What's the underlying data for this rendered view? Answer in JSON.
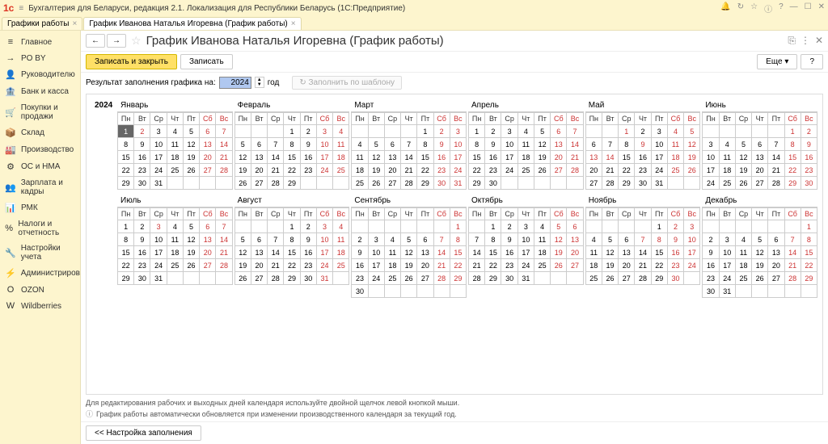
{
  "titlebar": {
    "logo": "1c",
    "title": "Бухгалтерия для Беларуси, редакция 2.1. Локализация для Республики Беларусь  (1С:Предприятие)"
  },
  "tabs": [
    {
      "label": "Графики работы",
      "active": false
    },
    {
      "label": "График Иванова Наталья Игоревна (График работы)",
      "active": true
    }
  ],
  "sidebar": [
    {
      "icon": "≡",
      "label": "Главное"
    },
    {
      "icon": "→",
      "label": "PO BY"
    },
    {
      "icon": "👤",
      "label": "Руководителю"
    },
    {
      "icon": "🏦",
      "label": "Банк и касса"
    },
    {
      "icon": "🛒",
      "label": "Покупки и продажи"
    },
    {
      "icon": "📦",
      "label": "Склад"
    },
    {
      "icon": "🏭",
      "label": "Производство"
    },
    {
      "icon": "⚙",
      "label": "ОС и НМА"
    },
    {
      "icon": "👥",
      "label": "Зарплата и кадры"
    },
    {
      "icon": "📊",
      "label": "РМК"
    },
    {
      "icon": "%",
      "label": "Налоги и отчетность"
    },
    {
      "icon": "🔧",
      "label": "Настройки учета"
    },
    {
      "icon": "⚡",
      "label": "Администрирование"
    },
    {
      "icon": "O",
      "label": "OZON"
    },
    {
      "icon": "W",
      "label": "Wildberries"
    }
  ],
  "header": {
    "title": "График Иванова Наталья Игоревна (График работы)"
  },
  "toolbar": {
    "save_close": "Записать и закрыть",
    "save": "Записать",
    "more": "Еще"
  },
  "filter": {
    "label_prefix": "Результат заполнения графика на:",
    "year": "2024",
    "label_suffix": "год",
    "template_btn": "Заполнить по шаблону"
  },
  "weekdays": [
    "Пн",
    "Вт",
    "Ср",
    "Чт",
    "Пт",
    "Сб",
    "Вс"
  ],
  "months_row1": [
    {
      "name": "Январь",
      "start": 0,
      "days": 31,
      "wknd": [
        6,
        7,
        13,
        14,
        20,
        21,
        27,
        28,
        1,
        2
      ],
      "today": 1
    },
    {
      "name": "Февраль",
      "start": 3,
      "days": 29,
      "wknd": [
        3,
        4,
        10,
        11,
        17,
        18,
        24,
        25
      ]
    },
    {
      "name": "Март",
      "start": 4,
      "days": 31,
      "wknd": [
        2,
        3,
        9,
        10,
        16,
        17,
        23,
        24,
        30,
        31
      ]
    },
    {
      "name": "Апрель",
      "start": 0,
      "days": 30,
      "wknd": [
        6,
        7,
        13,
        14,
        20,
        21,
        27,
        28
      ]
    },
    {
      "name": "Май",
      "start": 2,
      "days": 31,
      "wknd": [
        4,
        5,
        11,
        12,
        18,
        19,
        25,
        26,
        1,
        9,
        13,
        14
      ]
    },
    {
      "name": "Июнь",
      "start": 5,
      "days": 30,
      "wknd": [
        1,
        2,
        8,
        9,
        15,
        16,
        22,
        23,
        29,
        30
      ]
    }
  ],
  "months_row2": [
    {
      "name": "Июль",
      "start": 0,
      "days": 31,
      "wknd": [
        6,
        7,
        13,
        14,
        20,
        21,
        27,
        28,
        3
      ]
    },
    {
      "name": "Август",
      "start": 3,
      "days": 31,
      "wknd": [
        3,
        4,
        10,
        11,
        17,
        18,
        24,
        25,
        31
      ]
    },
    {
      "name": "Сентябрь",
      "start": 6,
      "days": 30,
      "wknd": [
        1,
        7,
        8,
        14,
        15,
        21,
        22,
        28,
        29
      ]
    },
    {
      "name": "Октябрь",
      "start": 1,
      "days": 31,
      "wknd": [
        5,
        6,
        12,
        13,
        19,
        20,
        26,
        27
      ]
    },
    {
      "name": "Ноябрь",
      "start": 4,
      "days": 30,
      "wknd": [
        2,
        3,
        9,
        10,
        16,
        17,
        23,
        24,
        30,
        7,
        8
      ]
    },
    {
      "name": "Декабрь",
      "start": 6,
      "days": 31,
      "wknd": [
        1,
        7,
        8,
        14,
        15,
        21,
        22,
        28,
        29
      ]
    }
  ],
  "year_label": "2024",
  "footer": {
    "line1": "Для редактирования рабочих и выходных дней календаря используйте двойной щелчок левой кнопкой мыши.",
    "line2": "График работы автоматически обновляется при изменении производственного календаря за текущий год.",
    "settings": "Настройка заполнения"
  }
}
